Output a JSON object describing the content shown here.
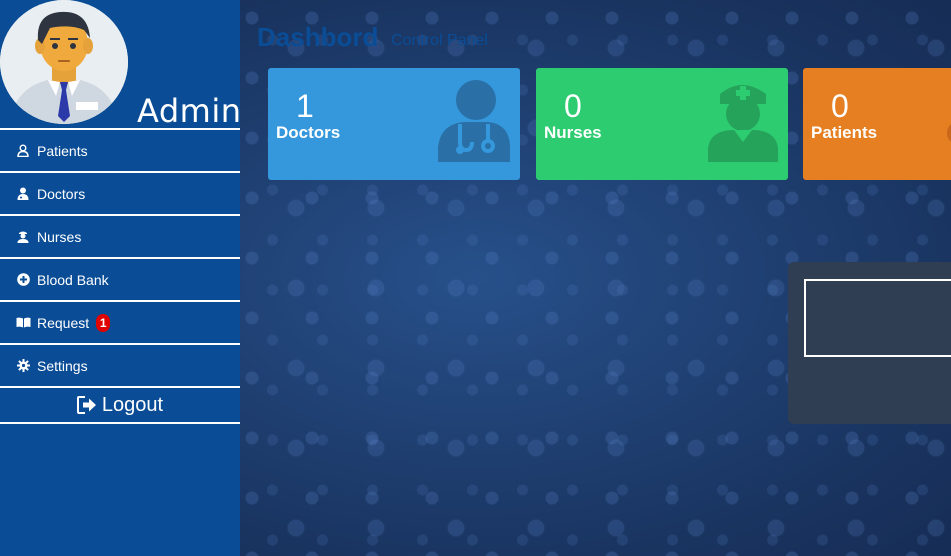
{
  "sidebar": {
    "user_label": "Admin",
    "items": [
      {
        "label": "Patients",
        "icon": "user-icon"
      },
      {
        "label": "Doctors",
        "icon": "doctor-icon"
      },
      {
        "label": "Nurses",
        "icon": "nurse-icon"
      },
      {
        "label": "Blood Bank",
        "icon": "plus-circle-icon"
      },
      {
        "label": "Request",
        "icon": "book-icon",
        "badge": "1"
      },
      {
        "label": "Settings",
        "icon": "gear-icon"
      }
    ],
    "logout_label": "Logout"
  },
  "header": {
    "title": "Dashbord",
    "subtitle": "Control Panel"
  },
  "stats": {
    "doctors": {
      "count": "1",
      "label": "Doctors",
      "color": "#3598dc"
    },
    "nurses": {
      "count": "0",
      "label": "Nurses",
      "color": "#2ecc71"
    },
    "patients": {
      "count": "0",
      "label": "Patients",
      "color": "#e67e22"
    }
  },
  "colors": {
    "sidebar": "#0a4d96",
    "badge": "#e00000",
    "panel": "#2f3e52"
  }
}
